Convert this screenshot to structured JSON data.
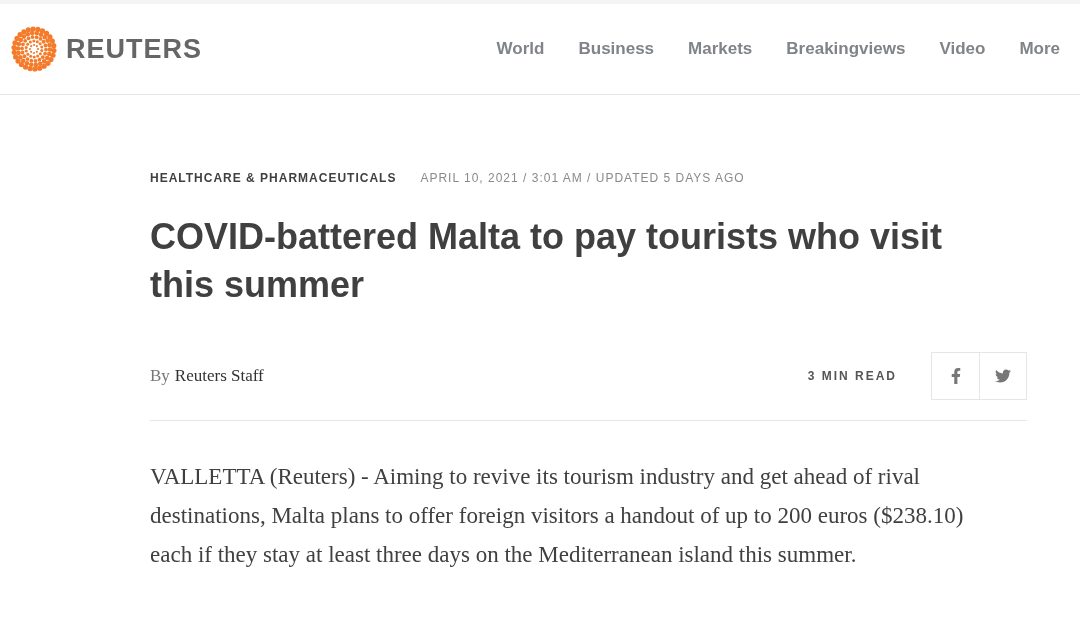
{
  "header": {
    "brand": "REUTERS",
    "nav": [
      {
        "label": "World"
      },
      {
        "label": "Business"
      },
      {
        "label": "Markets"
      },
      {
        "label": "Breakingviews"
      },
      {
        "label": "Video"
      },
      {
        "label": "More"
      }
    ]
  },
  "article": {
    "section": "HEALTHCARE & PHARMACEUTICALS",
    "dateline": "APRIL 10, 2021 / 3:01 AM / UPDATED 5 DAYS AGO",
    "headline": "COVID-battered Malta to pay tourists who visit this summer",
    "byline": {
      "prefix": "By",
      "author": "Reuters Staff"
    },
    "read_time": "3 MIN READ",
    "share": [
      {
        "kind": "facebook"
      },
      {
        "kind": "twitter"
      }
    ],
    "body": "VALLETTA (Reuters) - Aiming to revive its tourism industry and get ahead of rival destinations, Malta plans to offer foreign visitors a handout of up to 200 euros ($238.10) each if they stay at least three days on the Mediterranean island this summer."
  }
}
